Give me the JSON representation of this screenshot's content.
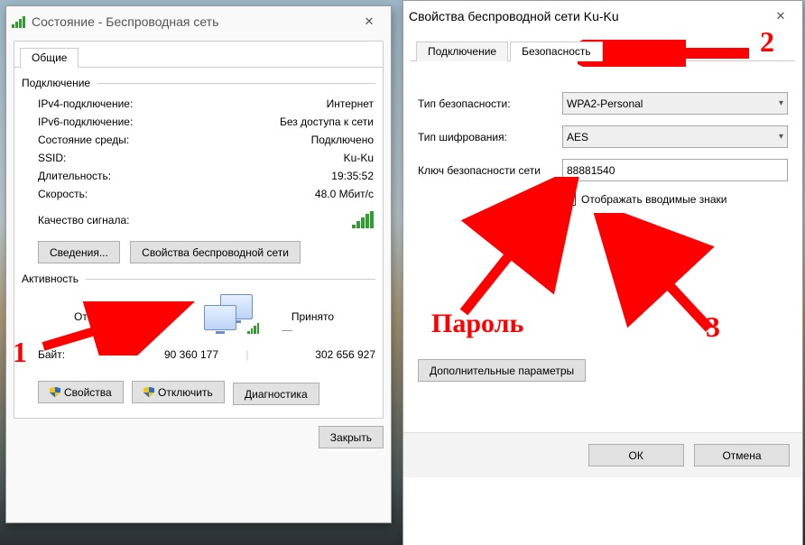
{
  "w1": {
    "title": "Состояние - Беспроводная сеть",
    "tab_general": "Общие",
    "sec_conn": "Подключение",
    "ipv4_lbl": "IPv4-подключение:",
    "ipv4_val": "Интернет",
    "ipv6_lbl": "IPv6-подключение:",
    "ipv6_val": "Без доступа к сети",
    "media_lbl": "Состояние среды:",
    "media_val": "Подключено",
    "ssid_lbl": "SSID:",
    "ssid_val": "Ku-Ku",
    "dur_lbl": "Длительность:",
    "dur_val": "19:35:52",
    "speed_lbl": "Скорость:",
    "speed_val": "48.0 Мбит/с",
    "quality_lbl": "Качество сигнала:",
    "btn_details": "Сведения...",
    "btn_wprops": "Свойства беспроводной сети",
    "sec_activity": "Активность",
    "sent_lbl": "Отправлено",
    "recv_lbl": "Принято",
    "bytes_lbl": "Байт:",
    "bytes_sent": "90 360 177",
    "bytes_recv": "302 656 927",
    "btn_props": "Свойства",
    "btn_disable": "Отключить",
    "btn_diag": "Диагностика",
    "btn_close": "Закрыть"
  },
  "w2": {
    "title": "Свойства беспроводной сети Ku-Ku",
    "tab_conn": "Подключение",
    "tab_sec": "Безопасность",
    "sectype_lbl": "Тип безопасности:",
    "sectype_val": "WPA2-Personal",
    "enc_lbl": "Тип шифрования:",
    "enc_val": "AES",
    "key_lbl": "Ключ безопасности сети",
    "key_val": "88881540",
    "show_chars": "Отображать вводимые знаки",
    "btn_adv": "Дополнительные параметры",
    "btn_ok": "ОК",
    "btn_cancel": "Отмена"
  },
  "ann": {
    "n1": "1",
    "n2": "2",
    "n3": "3",
    "pwd": "Пароль"
  }
}
